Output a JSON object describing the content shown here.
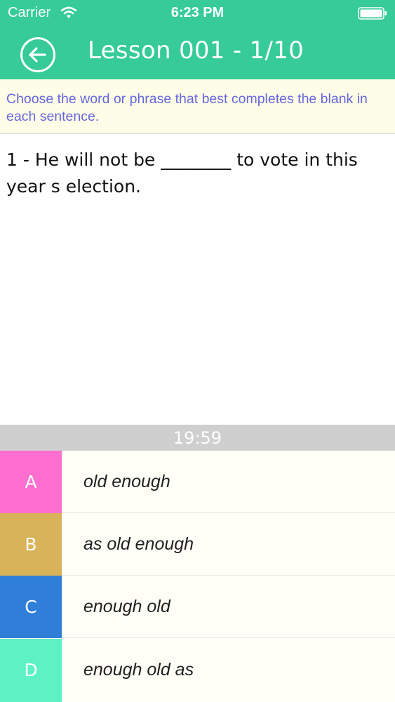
{
  "status_bar": {
    "carrier": "Carrier",
    "time": "6:23 PM"
  },
  "header": {
    "title": "Lesson 001 - 1/10",
    "background_color": "#36cb98"
  },
  "instruction": {
    "text": "Choose the word or phrase that best completes the blank in each sentence."
  },
  "question": {
    "text": "1 - He will not be ________ to vote in this year s election."
  },
  "timer": {
    "text": "19:59"
  },
  "options": [
    {
      "letter": "A",
      "text": "old enough",
      "color": "#ff6fcf"
    },
    {
      "letter": "B",
      "text": "as old enough",
      "color": "#d9b35a"
    },
    {
      "letter": "C",
      "text": "enough old",
      "color": "#2f7fd8"
    },
    {
      "letter": "D",
      "text": "enough old as",
      "color": "#5df2c4"
    }
  ]
}
